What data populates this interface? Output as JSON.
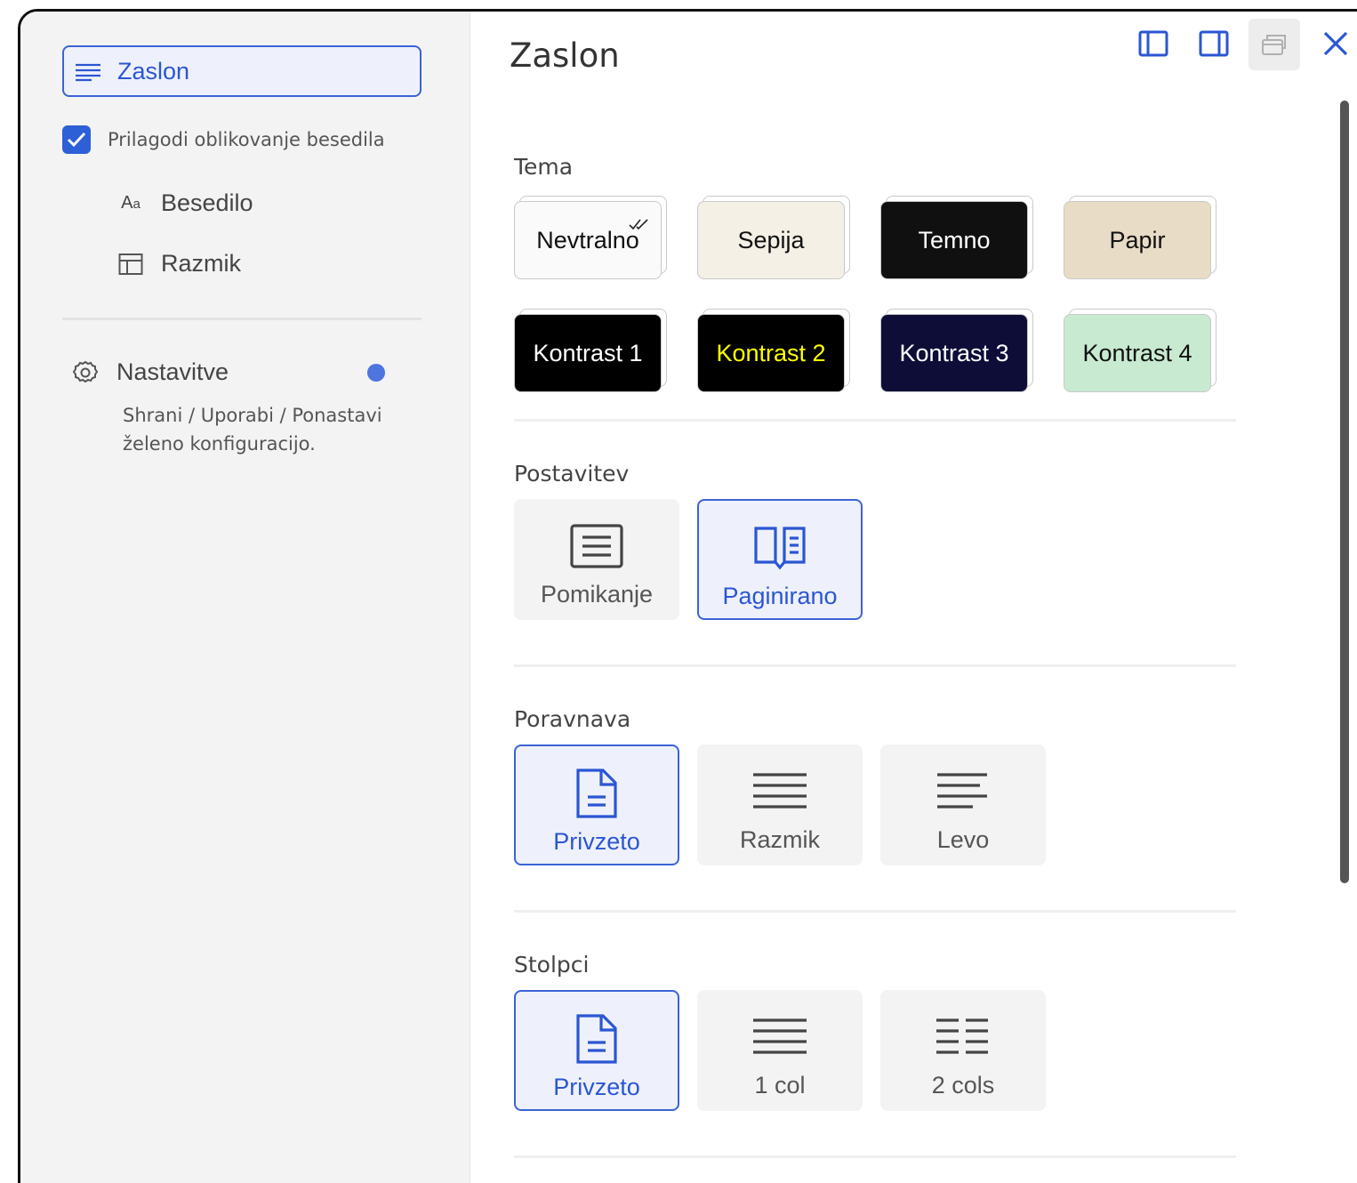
{
  "sidebar": {
    "active_item": {
      "label": "Zaslon",
      "icon": "align-left-icon"
    },
    "customize_checkbox": {
      "label": "Prilagodi oblikovanje besedila",
      "checked": true
    },
    "sub_items": [
      {
        "label": "Besedilo",
        "icon": "Aa"
      },
      {
        "label": "Razmik",
        "icon": "layout-icon"
      }
    ],
    "settings": {
      "label": "Nastavitve",
      "icon": "gear-icon",
      "description": "Shrani / Uporabi / Ponastavi želeno konfiguracijo."
    }
  },
  "main": {
    "title": "Zaslon",
    "window_controls": [
      "dock-left-icon",
      "dock-right-icon",
      "restore-window-icon",
      "close-icon"
    ],
    "theme": {
      "label": "Tema",
      "options": [
        {
          "label": "Nevtralno",
          "bg": "#fafafa",
          "fg": "#111111",
          "selected": true
        },
        {
          "label": "Sepija",
          "bg": "#f4f0e6",
          "fg": "#111111"
        },
        {
          "label": "Temno",
          "bg": "#101010",
          "fg": "#ffffff"
        },
        {
          "label": "Papir",
          "bg": "#e9dcc6",
          "fg": "#111111"
        },
        {
          "label": "Kontrast 1",
          "bg": "#000000",
          "fg": "#ffffff"
        },
        {
          "label": "Kontrast 2",
          "bg": "#000000",
          "fg": "#ffff00"
        },
        {
          "label": "Kontrast 3",
          "bg": "#0d0d38",
          "fg": "#ffffff"
        },
        {
          "label": "Kontrast 4",
          "bg": "#c8ead1",
          "fg": "#111111"
        }
      ]
    },
    "layout": {
      "label": "Postavitev",
      "options": [
        {
          "label": "Pomikanje",
          "icon": "document-lines-icon",
          "selected": false
        },
        {
          "label": "Paginirano",
          "icon": "open-book-icon",
          "selected": true
        }
      ]
    },
    "alignment": {
      "label": "Poravnava",
      "options": [
        {
          "label": "Privzeto",
          "icon": "file-icon",
          "selected": true
        },
        {
          "label": "Razmik",
          "icon": "justify-icon",
          "selected": false
        },
        {
          "label": "Levo",
          "icon": "align-left-icon",
          "selected": false
        }
      ]
    },
    "columns": {
      "label": "Stolpci",
      "options": [
        {
          "label": "Privzeto",
          "icon": "file-icon",
          "selected": true
        },
        {
          "label": "1 col",
          "icon": "one-column-icon",
          "selected": false
        },
        {
          "label": "2 cols",
          "icon": "two-columns-icon",
          "selected": false
        }
      ]
    }
  },
  "colors": {
    "accent": "#2b56d3",
    "sidebar_bg": "#f3f3f3",
    "dot": "#4e74dd"
  }
}
